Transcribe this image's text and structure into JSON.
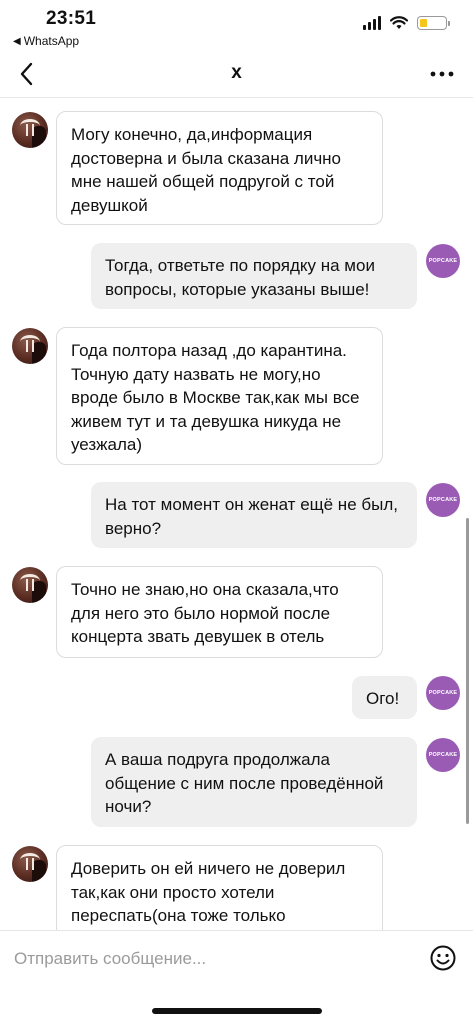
{
  "status_bar": {
    "time": "23:51",
    "back_app": "WhatsApp",
    "back_arrow": "◀"
  },
  "header": {
    "title": "x",
    "back_icon": "chevron-left-icon",
    "more_icon": "ellipsis-icon"
  },
  "messages": [
    {
      "side": "in",
      "text": "Могу конечно, да,информация достоверна и была сказана лично мне нашей общей подругой с той девушкой"
    },
    {
      "side": "out",
      "text": "Тогда, ответьте по порядку на мои вопросы, которые указаны выше!",
      "avatar": "POPCAKE"
    },
    {
      "side": "in",
      "text": "Года полтора назад ,до карантина. Точную дату назвать не могу,но вроде было в Москве так,как мы все живем тут и та девушка никуда не уезжала)"
    },
    {
      "side": "out",
      "text": "На тот момент он женат ещё не был, верно?",
      "avatar": "POPCAKE"
    },
    {
      "side": "in",
      "text": "Точно не знаю,но она сказала,что для него это было нормой после концерта звать девушек в отель"
    },
    {
      "side": "out",
      "text": "Ого!",
      "avatar": "POPCAKE"
    },
    {
      "side": "out",
      "text": "А ваша подруга продолжала общение с ним после проведённой ночи?",
      "avatar": "POPCAKE"
    },
    {
      "side": "in",
      "text": "Доверить он ей ничего не доверил так,как они просто хотели переспать(она тоже только"
    }
  ],
  "input": {
    "placeholder": "Отправить сообщение..."
  },
  "colors": {
    "outgoing_bubble": "#efefef",
    "incoming_border": "#dcdcdc",
    "popcake_avatar": "#9a5bb5",
    "battery_fill": "#f5c518"
  }
}
